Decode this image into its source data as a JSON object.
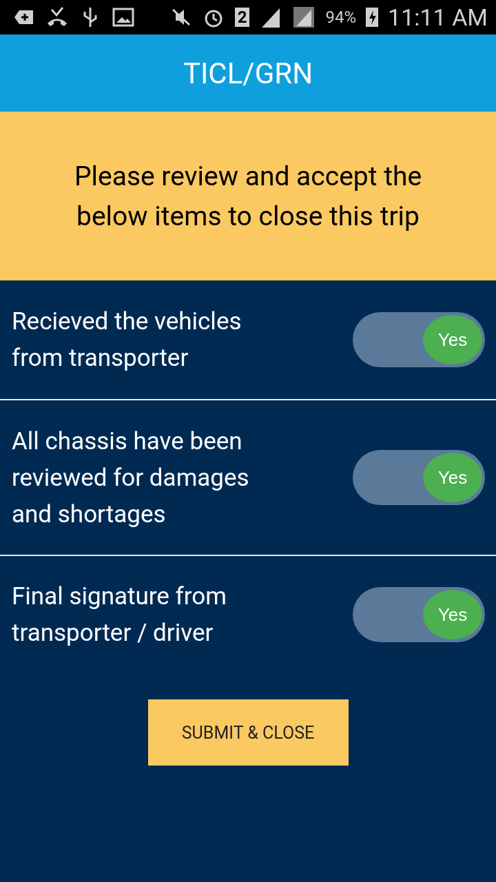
{
  "status_bar": {
    "sim_number": "2",
    "battery": "94%",
    "time": "11:11 AM"
  },
  "header": {
    "title": "TICL/GRN"
  },
  "banner": {
    "text": "Please review and accept the below items to close this trip"
  },
  "items": [
    {
      "label": "Recieved the vehicles from transporter",
      "toggle": {
        "on": true,
        "label": "Yes"
      }
    },
    {
      "label": "All chassis have been reviewed for damages and shortages",
      "toggle": {
        "on": true,
        "label": "Yes"
      }
    },
    {
      "label": "Final signature from transporter / driver",
      "toggle": {
        "on": true,
        "label": "Yes"
      }
    }
  ],
  "submit_button": {
    "label": "SUBMIT & CLOSE"
  }
}
